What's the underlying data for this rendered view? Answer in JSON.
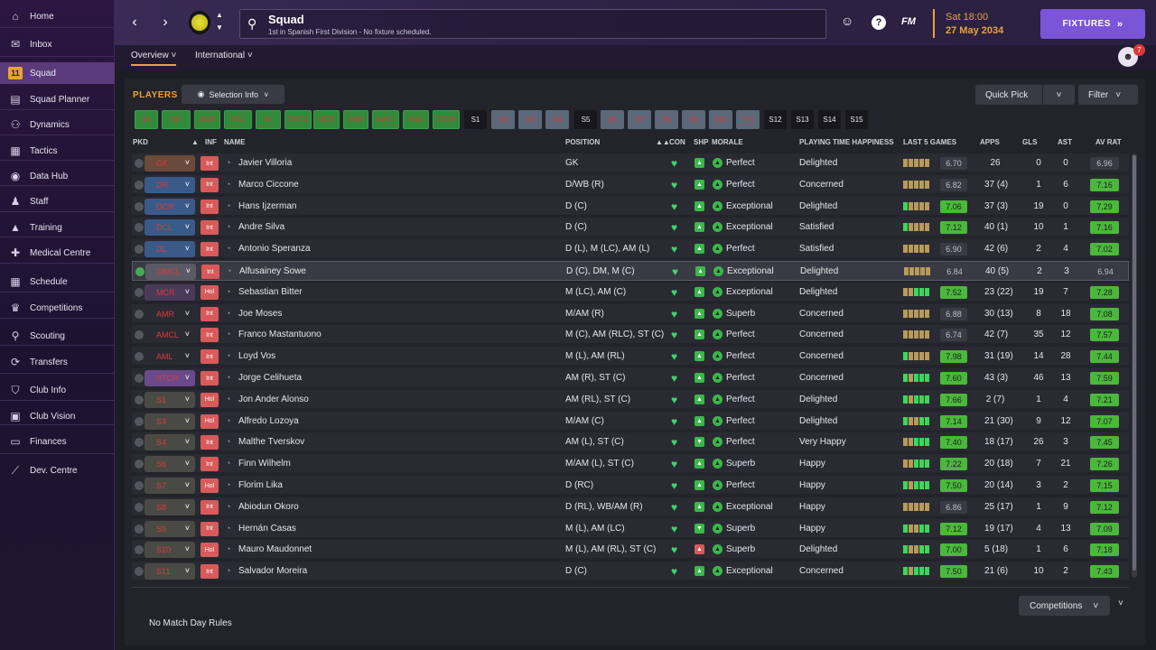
{
  "sidebar": {
    "items": [
      {
        "label": "Home",
        "icon": "home-icon",
        "glyph": "⌂"
      },
      {
        "label": "Inbox",
        "icon": "inbox-icon",
        "glyph": "✉"
      },
      {
        "label": "Squad",
        "icon": "squad-icon",
        "glyph": "11",
        "active": true
      },
      {
        "label": "Squad Planner",
        "icon": "planner-icon",
        "glyph": "▤"
      },
      {
        "label": "Dynamics",
        "icon": "dynamics-icon",
        "glyph": "⚇"
      },
      {
        "label": "Tactics",
        "icon": "tactics-icon",
        "glyph": "▦"
      },
      {
        "label": "Data Hub",
        "icon": "data-hub-icon",
        "glyph": "◉"
      },
      {
        "label": "Staff",
        "icon": "staff-icon",
        "glyph": "♟"
      },
      {
        "label": "Training",
        "icon": "training-icon",
        "glyph": "▲"
      },
      {
        "label": "Medical Centre",
        "icon": "medical-icon",
        "glyph": "✚"
      },
      {
        "label": "Schedule",
        "icon": "schedule-icon",
        "glyph": "▦"
      },
      {
        "label": "Competitions",
        "icon": "trophy-icon",
        "glyph": "♛"
      },
      {
        "label": "Scouting",
        "icon": "scouting-icon",
        "glyph": "⚲"
      },
      {
        "label": "Transfers",
        "icon": "transfers-icon",
        "glyph": "⟳"
      },
      {
        "label": "Club Info",
        "icon": "shield-icon",
        "glyph": "⛉"
      },
      {
        "label": "Club Vision",
        "icon": "vision-icon",
        "glyph": "▣"
      },
      {
        "label": "Finances",
        "icon": "finances-icon",
        "glyph": "▭"
      },
      {
        "label": "Dev. Centre",
        "icon": "dev-centre-icon",
        "glyph": "⟋"
      }
    ]
  },
  "header": {
    "title": "Squad",
    "subtitle": "1st in Spanish First Division - No fixture scheduled.",
    "date_day": "Sat 18:00",
    "date_full": "27 May 2034",
    "fixtures_label": "FIXTURES",
    "fm_label": "FM",
    "notif_count": "7"
  },
  "subnav": {
    "tabs": [
      "Overview",
      "International"
    ]
  },
  "panel": {
    "players_label": "PLAYERS",
    "selection_info": "Selection Info",
    "quick_pick": "Quick Pick",
    "filter": "Filter",
    "competitions": "Competitions",
    "no_rules": "No Match Day Rules"
  },
  "position_chips": [
    {
      "label": "GK",
      "style": "green"
    },
    {
      "label": "DR",
      "style": "green"
    },
    {
      "label": "DCR",
      "style": "green"
    },
    {
      "label": "DCL",
      "style": "green"
    },
    {
      "label": "DL",
      "style": "green"
    },
    {
      "label": "DMCL",
      "style": "green"
    },
    {
      "label": "MCR",
      "style": "green"
    },
    {
      "label": "AMR",
      "style": "green"
    },
    {
      "label": "AMCL",
      "style": "green"
    },
    {
      "label": "AML",
      "style": "green"
    },
    {
      "label": "STCR",
      "style": "green"
    },
    {
      "label": "S1",
      "style": "dark"
    },
    {
      "label": "S2",
      "style": "grey"
    },
    {
      "label": "S3",
      "style": "grey"
    },
    {
      "label": "S4",
      "style": "grey"
    },
    {
      "label": "S5",
      "style": "dark"
    },
    {
      "label": "S6",
      "style": "grey"
    },
    {
      "label": "S7",
      "style": "grey"
    },
    {
      "label": "S8",
      "style": "grey"
    },
    {
      "label": "S9",
      "style": "grey"
    },
    {
      "label": "S10",
      "style": "grey"
    },
    {
      "label": "S11",
      "style": "grey"
    },
    {
      "label": "S12",
      "style": "dark"
    },
    {
      "label": "S13",
      "style": "dark"
    },
    {
      "label": "S14",
      "style": "dark"
    },
    {
      "label": "S15",
      "style": "dark"
    }
  ],
  "columns": [
    "PKD",
    "INF",
    "NAME",
    "POSITION",
    "CON",
    "SHP",
    "MORALE",
    "PLAYING TIME HAPPINESS",
    "LAST 5 GAMES",
    "APPS",
    "GLS",
    "AST",
    "AV RAT"
  ],
  "players": [
    {
      "pkd": "GK",
      "inf": "Int",
      "name": "Javier Villoria",
      "position": "GK",
      "morale": "Perfect",
      "pth": "Delighted",
      "last5": "6.70",
      "l5good": false,
      "bars": "bbbbb",
      "apps": "26",
      "gls": "0",
      "ast": "0",
      "avrat": "6.96",
      "avgood": false,
      "chip": "#6a4a3a",
      "shp": "up"
    },
    {
      "pkd": "DR",
      "inf": "Int",
      "name": "Marco Ciccone",
      "position": "D/WB (R)",
      "morale": "Perfect",
      "pth": "Concerned",
      "last5": "6.82",
      "l5good": false,
      "bars": "bbbbb",
      "apps": "37 (4)",
      "gls": "1",
      "ast": "6",
      "avrat": "7.16",
      "avgood": true,
      "chip": "#3a5a8a",
      "shp": "up"
    },
    {
      "pkd": "DCR",
      "inf": "Int",
      "name": "Hans Ijzerman",
      "position": "D (C)",
      "morale": "Exceptional",
      "pth": "Delighted",
      "last5": "7.06",
      "l5good": true,
      "bars": "gbbbb",
      "apps": "37 (3)",
      "gls": "19",
      "ast": "0",
      "avrat": "7.29",
      "avgood": true,
      "chip": "#3a5a8a",
      "shp": "up"
    },
    {
      "pkd": "DCL",
      "inf": "Int",
      "name": "Andre Silva",
      "position": "D (C)",
      "morale": "Exceptional",
      "pth": "Satisfied",
      "last5": "7.12",
      "l5good": true,
      "bars": "gbbbb",
      "apps": "40 (1)",
      "gls": "10",
      "ast": "1",
      "avrat": "7.16",
      "avgood": true,
      "chip": "#3a5a8a",
      "shp": "up"
    },
    {
      "pkd": "DL",
      "inf": "Int",
      "name": "Antonio Speranza",
      "position": "D (L), M (LC), AM (L)",
      "morale": "Perfect",
      "pth": "Satisfied",
      "last5": "6.90",
      "l5good": false,
      "bars": "bbbbb",
      "apps": "42 (6)",
      "gls": "2",
      "ast": "4",
      "avrat": "7.02",
      "avgood": true,
      "chip": "#3a5a8a",
      "shp": "up"
    },
    {
      "pkd": "DMCL",
      "inf": "Int",
      "name": "Alfusainey Sowe",
      "position": "D (C), DM, M (C)",
      "morale": "Exceptional",
      "pth": "Delighted",
      "last5": "6.84",
      "l5good": false,
      "bars": "bbbbb",
      "apps": "40 (5)",
      "gls": "2",
      "ast": "3",
      "avrat": "6.94",
      "avgood": false,
      "chip": "#5a5a66",
      "shp": "up",
      "selected": true
    },
    {
      "pkd": "MCR",
      "inf": "Hol",
      "name": "Sebastian Bitter",
      "position": "M (LC), AM (C)",
      "morale": "Exceptional",
      "pth": "Delighted",
      "last5": "7.52",
      "l5good": true,
      "bars": "bbggg",
      "apps": "23 (22)",
      "gls": "19",
      "ast": "7",
      "avrat": "7.28",
      "avgood": true,
      "chip": "#4a3a5a",
      "shp": "up"
    },
    {
      "pkd": "AMR",
      "inf": "Int",
      "name": "Joe Moses",
      "position": "M/AM (R)",
      "morale": "Superb",
      "pth": "Concerned",
      "last5": "6.88",
      "l5good": false,
      "bars": "bbbbb",
      "apps": "30 (13)",
      "gls": "8",
      "ast": "18",
      "avrat": "7.08",
      "avgood": true,
      "chip": "#2a2a33",
      "shp": "up"
    },
    {
      "pkd": "AMCL",
      "inf": "Int",
      "name": "Franco Mastantuono",
      "position": "M (C), AM (RLC), ST (C)",
      "morale": "Perfect",
      "pth": "Concerned",
      "last5": "6.74",
      "l5good": false,
      "bars": "bbbbb",
      "apps": "42 (7)",
      "gls": "35",
      "ast": "12",
      "avrat": "7.57",
      "avgood": true,
      "chip": "#2a2a33",
      "shp": "up"
    },
    {
      "pkd": "AML",
      "inf": "Int",
      "name": "Loyd Vos",
      "position": "M (L), AM (RL)",
      "morale": "Perfect",
      "pth": "Concerned",
      "last5": "7.98",
      "l5good": true,
      "bars": "gbbbb",
      "apps": "31 (19)",
      "gls": "14",
      "ast": "28",
      "avrat": "7.44",
      "avgood": true,
      "chip": "#2a2a33",
      "shp": "up"
    },
    {
      "pkd": "STCR",
      "inf": "Int",
      "name": "Jorge Celihueta",
      "position": "AM (R), ST (C)",
      "morale": "Perfect",
      "pth": "Concerned",
      "last5": "7.60",
      "l5good": true,
      "bars": "gbggg",
      "apps": "43 (3)",
      "gls": "46",
      "ast": "13",
      "avrat": "7.59",
      "avgood": true,
      "chip": "#6a4a8a",
      "shp": "up"
    },
    {
      "pkd": "S1",
      "inf": "Hol",
      "name": "Jon Ander Alonso",
      "position": "AM (RL), ST (C)",
      "morale": "Perfect",
      "pth": "Delighted",
      "last5": "7.66",
      "l5good": true,
      "bars": "gbggg",
      "apps": "2 (7)",
      "gls": "1",
      "ast": "4",
      "avrat": "7.21",
      "avgood": true,
      "chip": "#4a4a44",
      "shp": "up"
    },
    {
      "pkd": "S3",
      "inf": "Hol",
      "name": "Alfredo Lozoya",
      "position": "M/AM (C)",
      "morale": "Perfect",
      "pth": "Delighted",
      "last5": "7.14",
      "l5good": true,
      "bars": "gbbgg",
      "apps": "21 (30)",
      "gls": "9",
      "ast": "12",
      "avrat": "7.07",
      "avgood": true,
      "chip": "#4a4a44",
      "shp": "up"
    },
    {
      "pkd": "S4",
      "inf": "Int",
      "name": "Malthe Tverskov",
      "position": "AM (L), ST (C)",
      "morale": "Perfect",
      "pth": "Very Happy",
      "last5": "7.40",
      "l5good": true,
      "bars": "bbggg",
      "apps": "18 (17)",
      "gls": "26",
      "ast": "3",
      "avrat": "7.45",
      "avgood": true,
      "chip": "#4a4a44",
      "shp": "down"
    },
    {
      "pkd": "S6",
      "inf": "Int",
      "name": "Finn Wilhelm",
      "position": "M/AM (L), ST (C)",
      "morale": "Superb",
      "pth": "Happy",
      "last5": "7.22",
      "l5good": true,
      "bars": "bbggg",
      "apps": "20 (18)",
      "gls": "7",
      "ast": "21",
      "avrat": "7.26",
      "avgood": true,
      "chip": "#4a4a44",
      "shp": "up"
    },
    {
      "pkd": "S7",
      "inf": "Hol",
      "name": "Florim Lika",
      "position": "D (RC)",
      "morale": "Perfect",
      "pth": "Happy",
      "last5": "7.50",
      "l5good": true,
      "bars": "gbggg",
      "apps": "20 (14)",
      "gls": "3",
      "ast": "2",
      "avrat": "7.15",
      "avgood": true,
      "chip": "#4a4a44",
      "shp": "up"
    },
    {
      "pkd": "S8",
      "inf": "Int",
      "name": "Abiodun Okoro",
      "position": "D (RL), WB/AM (R)",
      "morale": "Exceptional",
      "pth": "Happy",
      "last5": "6.86",
      "l5good": false,
      "bars": "bbbbb",
      "apps": "25 (17)",
      "gls": "1",
      "ast": "9",
      "avrat": "7.12",
      "avgood": true,
      "chip": "#4a4a44",
      "shp": "up"
    },
    {
      "pkd": "S9",
      "inf": "Int",
      "name": "Hernán Casas",
      "position": "M (L), AM (LC)",
      "morale": "Superb",
      "pth": "Happy",
      "last5": "7.12",
      "l5good": true,
      "bars": "gbbgg",
      "apps": "19 (17)",
      "gls": "4",
      "ast": "13",
      "avrat": "7.09",
      "avgood": true,
      "chip": "#4a4a44",
      "shp": "down"
    },
    {
      "pkd": "S10",
      "inf": "Hol",
      "name": "Mauro Maudonnet",
      "position": "M (L), AM (RL), ST (C)",
      "morale": "Superb",
      "pth": "Delighted",
      "last5": "7.00",
      "l5good": true,
      "bars": "gbbgg",
      "apps": "5 (18)",
      "gls": "1",
      "ast": "6",
      "avrat": "7.18",
      "avgood": true,
      "chip": "#4a4a44",
      "shp": "red"
    },
    {
      "pkd": "S11",
      "inf": "Int",
      "name": "Salvador Moreira",
      "position": "D (C)",
      "morale": "Exceptional",
      "pth": "Concerned",
      "last5": "7.50",
      "l5good": true,
      "bars": "gbggg",
      "apps": "21 (6)",
      "gls": "10",
      "ast": "2",
      "avrat": "7.43",
      "avgood": true,
      "chip": "#4a4a44",
      "shp": "up"
    }
  ]
}
